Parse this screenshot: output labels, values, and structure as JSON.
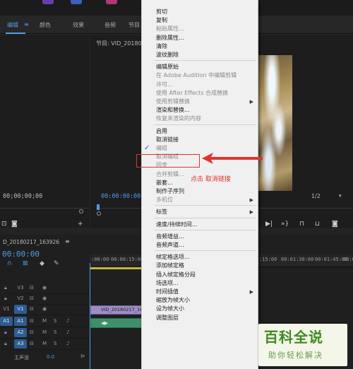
{
  "workspace_tabs": [
    "编辑",
    "颜色",
    "效果",
    "音频",
    "节目"
  ],
  "program": {
    "title": "节目: VID_2018021",
    "source_timecode": "00;00;00;00",
    "program_timecode": "00:00:00:00",
    "zoom": "1/2"
  },
  "timeline": {
    "sequence_name": "D_20180217_163926",
    "timecode": "00:00:00",
    "ruler_ticks": [
      ":00:00",
      "00:00:15:00",
      "00:00:30:00",
      ":15:00",
      "00:01:30:00",
      "00:01:45:00",
      "00:02"
    ],
    "tracks": [
      "V3",
      "V2",
      "V1",
      "A1",
      "A2",
      "A3"
    ],
    "master_label": "主声道",
    "master_value": "0.0",
    "clip_video_label": "VID_20180217_16392",
    "clip_audio_label": "◀▶"
  },
  "menu": {
    "items": [
      {
        "label": "剪切",
        "disabled": false
      },
      {
        "label": "复制",
        "disabled": false
      },
      {
        "label": "粘贴属性...",
        "disabled": true
      },
      {
        "label": "删除属性...",
        "disabled": false
      },
      {
        "label": "清除",
        "disabled": false
      },
      {
        "label": "波纹删除",
        "disabled": false
      },
      {
        "separator": true
      },
      {
        "label": "编辑原始",
        "disabled": false
      },
      {
        "label": "在 Adobe Audition 中编辑剪辑",
        "disabled": true
      },
      {
        "label": "许可...",
        "disabled": true
      },
      {
        "label": "使用 After Effects 合成替换",
        "disabled": true
      },
      {
        "label": "使用剪辑替换",
        "disabled": true,
        "submenu": true
      },
      {
        "label": "渲染和替换...",
        "disabled": false
      },
      {
        "label": "恢复未渲染的内容",
        "disabled": true
      },
      {
        "separator": true
      },
      {
        "label": "启用",
        "disabled": false,
        "checked": true
      },
      {
        "label": "取消链接",
        "disabled": false
      },
      {
        "label": "编组",
        "disabled": true
      },
      {
        "label": "取消编组",
        "disabled": true
      },
      {
        "label": "同步",
        "disabled": true
      },
      {
        "label": "合并剪辑...",
        "disabled": true
      },
      {
        "label": "嵌套...",
        "disabled": false
      },
      {
        "label": "制作子序列",
        "disabled": false
      },
      {
        "label": "多机位",
        "disabled": true,
        "submenu": true
      },
      {
        "separator": true
      },
      {
        "label": "标签",
        "disabled": false,
        "submenu": true
      },
      {
        "separator": true
      },
      {
        "label": "速度/持续时间...",
        "disabled": false
      },
      {
        "separator": true
      },
      {
        "label": "音频增益...",
        "disabled": false
      },
      {
        "label": "音频声道...",
        "disabled": false
      },
      {
        "separator": true
      },
      {
        "label": "帧定格选项...",
        "disabled": false
      },
      {
        "label": "添加帧定格",
        "disabled": false
      },
      {
        "label": "插入帧定格分段",
        "disabled": false
      },
      {
        "label": "场选项...",
        "disabled": false
      },
      {
        "label": "时间插值",
        "disabled": false,
        "submenu": true
      },
      {
        "label": "缩放为帧大小",
        "disabled": false
      },
      {
        "label": "设为帧大小",
        "disabled": false
      },
      {
        "label": "调整图层",
        "disabled": false
      }
    ]
  },
  "annotation": {
    "text": "点击  取消链接"
  },
  "watermark": {
    "title": "百科全说",
    "subtitle": "助你轻松解决"
  },
  "colors": {
    "accent": "#4f9de6",
    "annotation_red": "#e0342c",
    "watermark_green": "#3f8a1f"
  }
}
